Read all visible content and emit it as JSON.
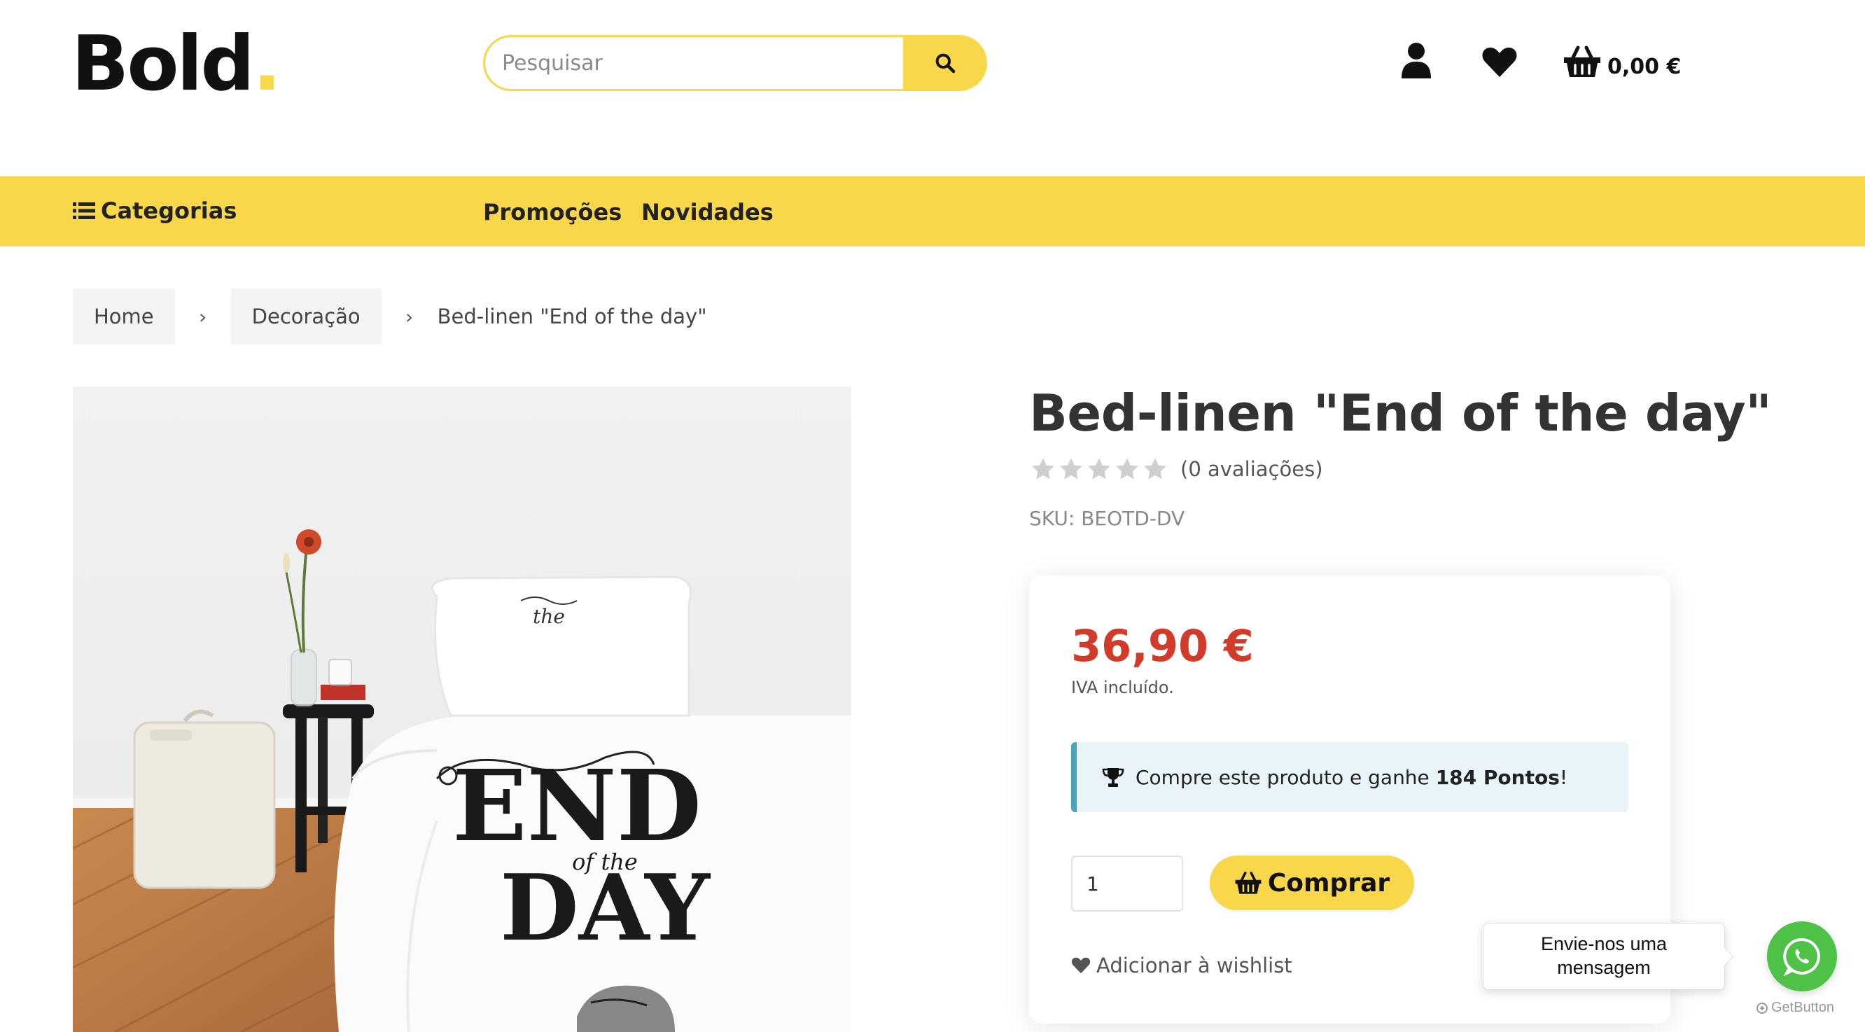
{
  "header": {
    "logo_text": "Bold",
    "logo_dot": ".",
    "search": {
      "placeholder": "Pesquisar",
      "value": ""
    },
    "cart_total": "0,00 €"
  },
  "nav": {
    "categories_label": "Categorias",
    "links": [
      {
        "label": "Promoções"
      },
      {
        "label": "Novidades"
      }
    ]
  },
  "breadcrumb": {
    "items": [
      {
        "label": "Home"
      },
      {
        "label": "Decoração"
      }
    ],
    "separator": "›",
    "current": "Bed-linen \"End of the day\""
  },
  "product": {
    "title": "Bed-linen \"End of the day\"",
    "rating": {
      "stars_filled": 0,
      "stars_total": 5,
      "count_label": "(0 avaliações)"
    },
    "sku_label": "SKU: BEOTD-DV",
    "price": "36,90 €",
    "vat_label": "IVA incluído.",
    "points_prefix": "Compre este produto e ganhe ",
    "points_value": "184 Pontos",
    "points_suffix": "!",
    "quantity": "1",
    "buy_label": "Comprar",
    "wishlist_label": "Adicionar à wishlist",
    "image_text": {
      "pillow": "the",
      "duvet_top": "END",
      "duvet_mid": "of the",
      "duvet_bottom": "DAY"
    }
  },
  "chat": {
    "bubble_text": "Envie-nos uma mensagem",
    "powered_by": "GetButton"
  },
  "colors": {
    "accent_yellow": "#f9d74a",
    "price_red": "#d23a2a",
    "points_bg": "#e8f4f8",
    "points_border": "#4aa3b8",
    "whatsapp_green": "#4dc247"
  }
}
